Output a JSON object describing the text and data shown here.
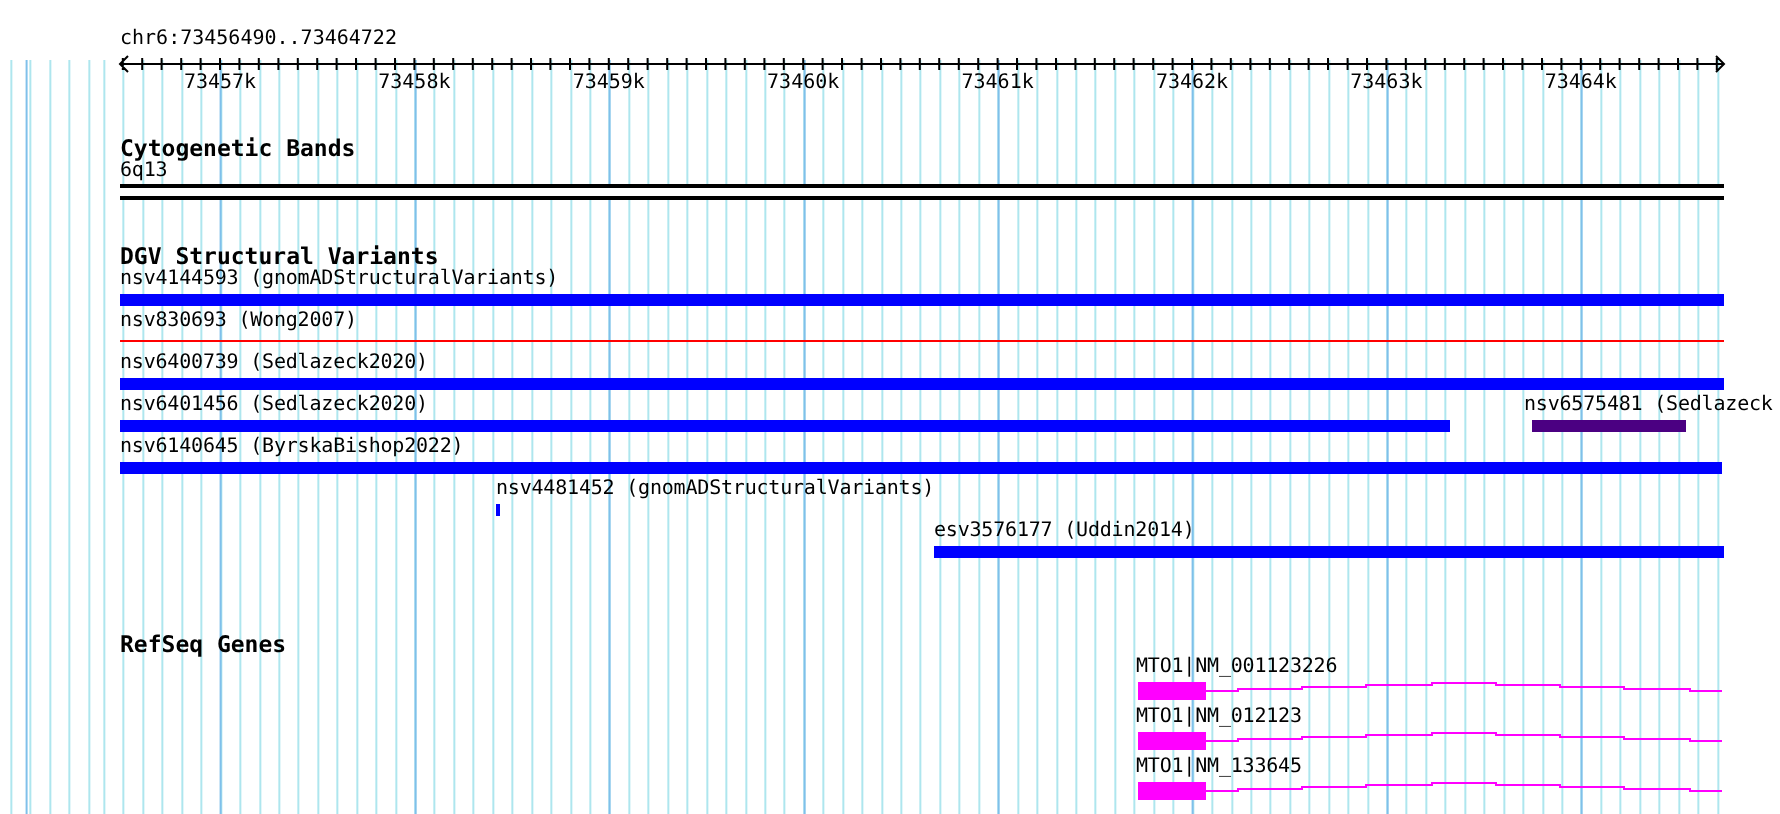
{
  "ruler": {
    "location": "chr6:73456490..73464722",
    "ticks": [
      "73457k",
      "73458k",
      "73459k",
      "73460k",
      "73461k",
      "73462k",
      "73463k",
      "73464k"
    ]
  },
  "tracks": [
    {
      "kind": "bands",
      "title": "Cytogenetic Bands",
      "features": [
        {
          "label": "6q13"
        }
      ]
    },
    {
      "kind": "variants",
      "title": "DGV Structural Variants",
      "features": [
        {
          "label": "nsv4144593 (gnomADStructuralVariants)",
          "kind": "bar",
          "color": "#0000ff"
        },
        {
          "label": "nsv830693 (Wong2007)",
          "kind": "line",
          "color": "#ff0000"
        },
        {
          "label": "nsv6400739 (Sedlazeck2020)",
          "kind": "bar",
          "color": "#0000ff"
        },
        {
          "label": "nsv6401456 (Sedlazeck2020)",
          "kind": "bar",
          "color": "#0000ff"
        },
        {
          "label": "nsv6575481 (Sedlazeck",
          "kind": "bar",
          "color": "#4b0082"
        },
        {
          "label": "nsv6140645 (ByrskaBishop2022)",
          "kind": "bar",
          "color": "#0000ff"
        },
        {
          "label": "nsv4481452 (gnomADStructuralVariants)",
          "kind": "bar",
          "color": "#0000ff"
        },
        {
          "label": "esv3576177 (Uddin2014)",
          "kind": "bar",
          "color": "#0000ff"
        }
      ]
    },
    {
      "kind": "genes",
      "title": "RefSeq Genes",
      "features": [
        {
          "label": "MTO1|NM_001123226"
        },
        {
          "label": "MTO1|NM_012123"
        },
        {
          "label": "MTO1|NM_133645"
        }
      ]
    }
  ]
}
